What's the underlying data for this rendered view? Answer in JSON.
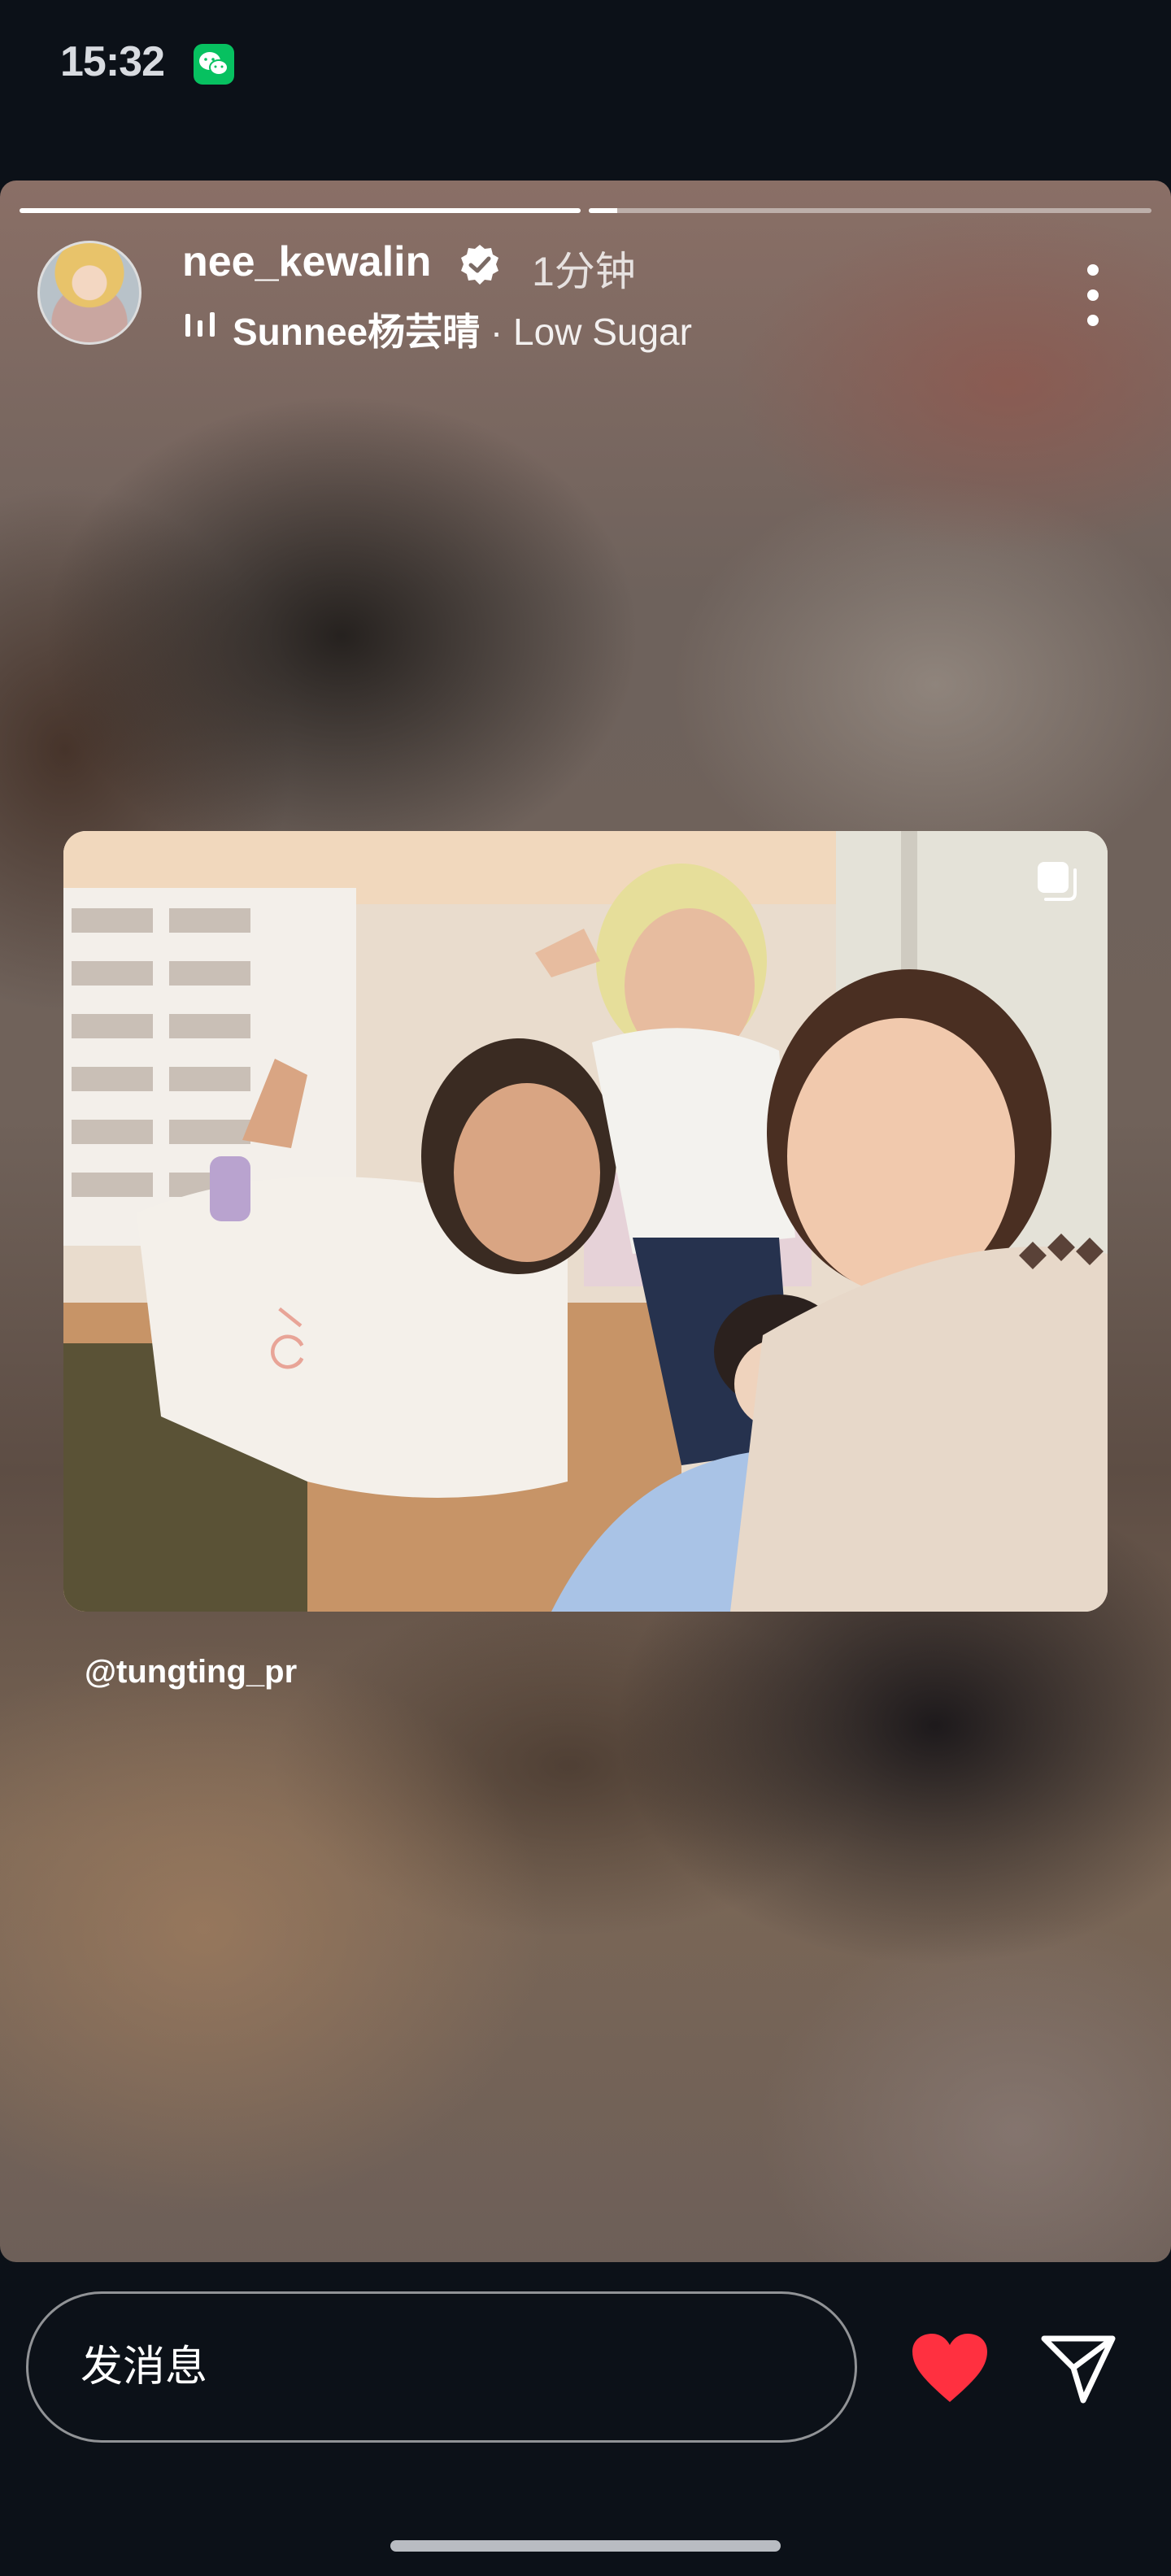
{
  "status_bar": {
    "time": "15:32",
    "notification_app_icon": "wechat-icon"
  },
  "story": {
    "progress_segments": [
      {
        "state": "viewed",
        "fill": 1.0
      },
      {
        "state": "current",
        "fill": 0.05
      }
    ],
    "header": {
      "username": "nee_kewalin",
      "verified": true,
      "time_ago": "1分钟",
      "music_artist": "Sunnee杨芸晴",
      "music_separator": " · ",
      "music_title": "Low Sugar",
      "more_icon": "more-vertical-icon"
    },
    "shared_post": {
      "author": "@tungting_pr",
      "carousel_icon": "multiple-photos-icon"
    }
  },
  "reply_bar": {
    "placeholder": "发消息",
    "like_icon": "heart-icon",
    "like_color": "#ff3040",
    "share_icon": "send-icon"
  }
}
